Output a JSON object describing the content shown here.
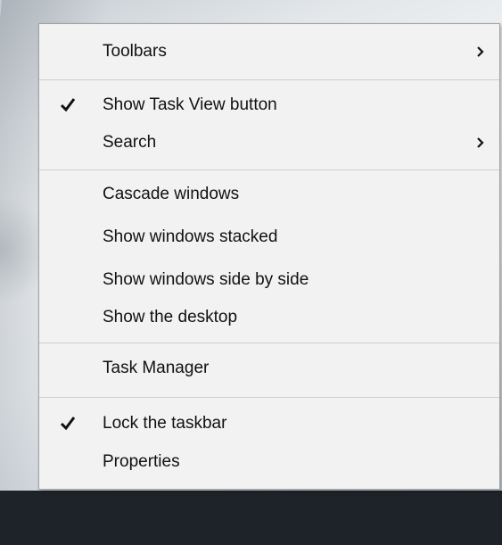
{
  "menu": {
    "items": [
      {
        "label": "Toolbars",
        "checked": false,
        "submenu": true
      },
      {
        "label": "Show Task View button",
        "checked": true,
        "submenu": false
      },
      {
        "label": "Search",
        "checked": false,
        "submenu": true
      },
      {
        "label": "Cascade windows",
        "checked": false,
        "submenu": false
      },
      {
        "label": "Show windows stacked",
        "checked": false,
        "submenu": false
      },
      {
        "label": "Show windows side by side",
        "checked": false,
        "submenu": false
      },
      {
        "label": "Show the desktop",
        "checked": false,
        "submenu": false
      },
      {
        "label": "Task Manager",
        "checked": false,
        "submenu": false
      },
      {
        "label": "Lock the taskbar",
        "checked": true,
        "submenu": false
      },
      {
        "label": "Properties",
        "checked": false,
        "submenu": false
      }
    ]
  },
  "icons": {
    "check": "checkmark-icon",
    "submenu": "chevron-right-icon"
  },
  "colors": {
    "menu_background": "#f2f2f2",
    "menu_border": "#a0a0a0",
    "separator": "#cfcfcf",
    "text": "#111111",
    "taskbar": "#1e2329"
  }
}
